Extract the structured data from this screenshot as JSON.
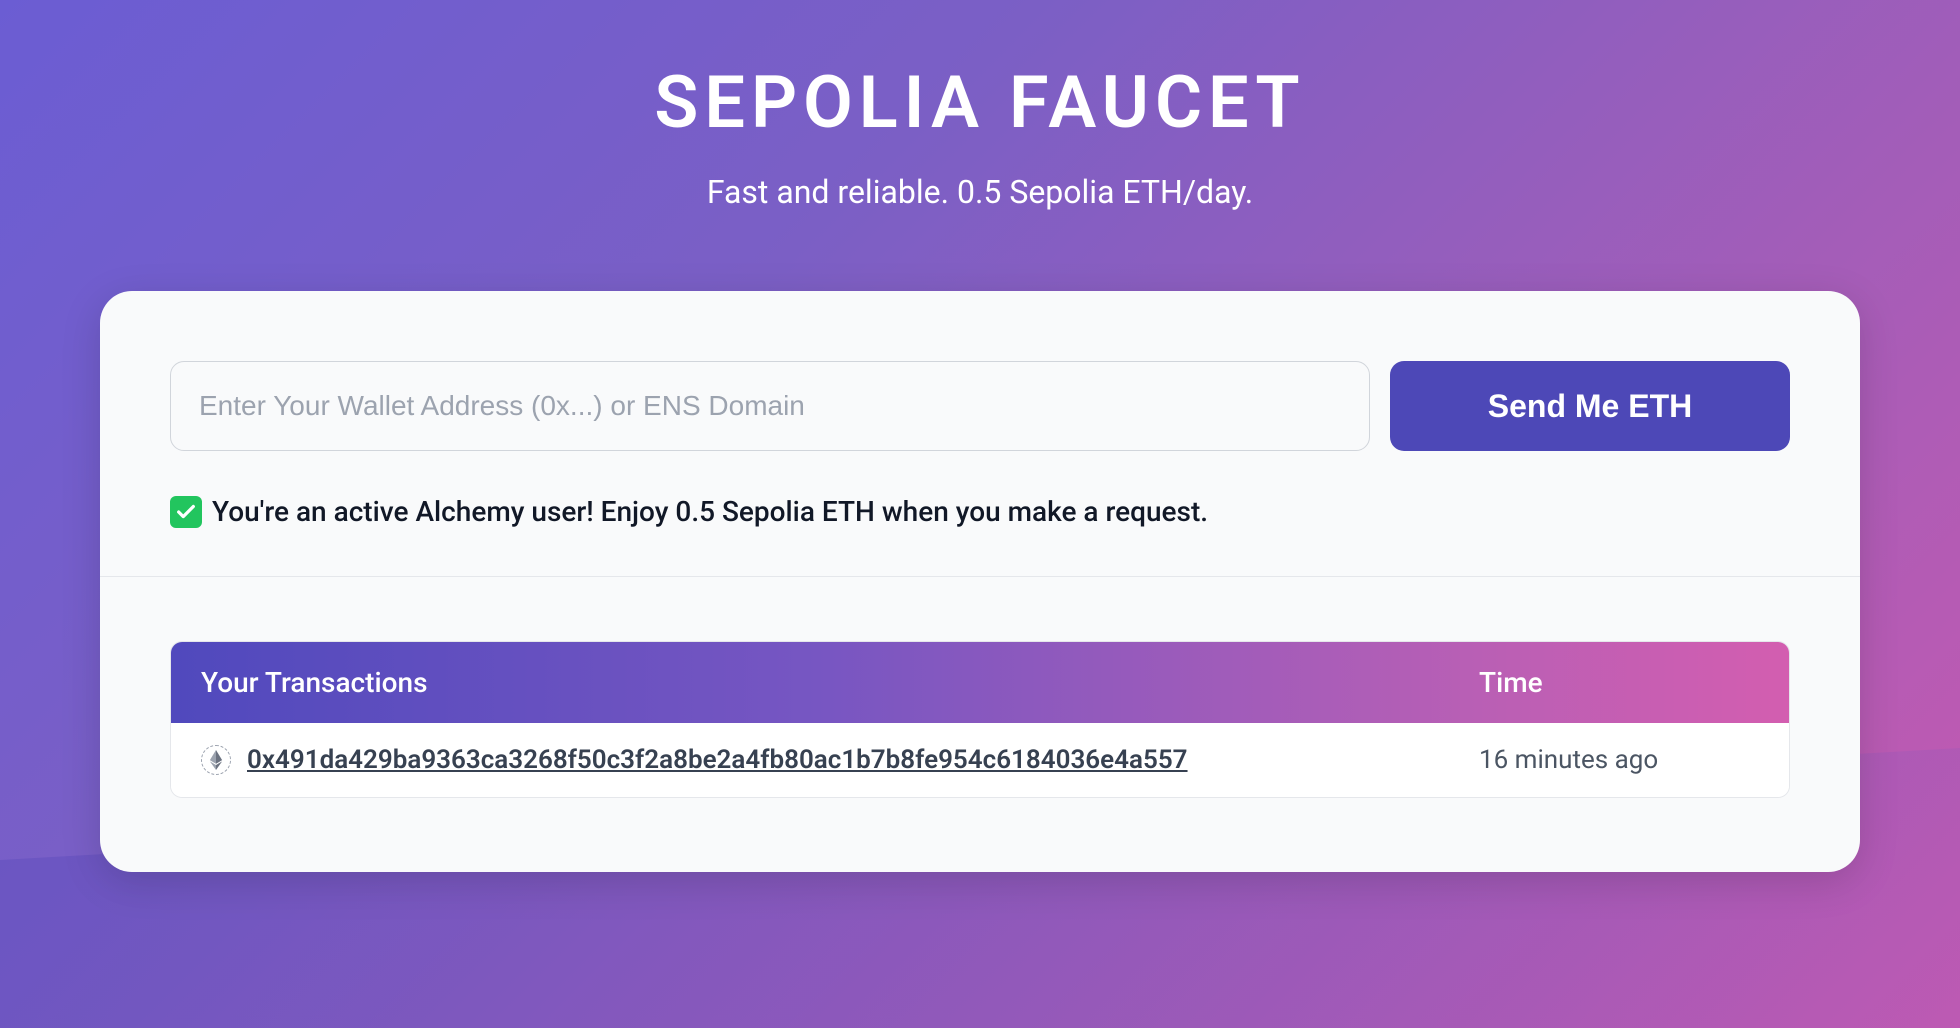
{
  "header": {
    "title": "SEPOLIA FAUCET",
    "subtitle": "Fast and reliable. 0.5 Sepolia ETH/day."
  },
  "form": {
    "wallet_placeholder": "Enter Your Wallet Address (0x...) or ENS Domain",
    "send_button_label": "Send Me ETH"
  },
  "status": {
    "message": "You're an active Alchemy user! Enjoy 0.5 Sepolia ETH when you make a request."
  },
  "transactions": {
    "header_tx_label": "Your Transactions",
    "header_time_label": "Time",
    "rows": [
      {
        "hash": "0x491da429ba9363ca3268f50c3f2a8be2a4fb80ac1b7b8fe954c6184036e4a557",
        "time": "16 minutes ago"
      }
    ]
  }
}
